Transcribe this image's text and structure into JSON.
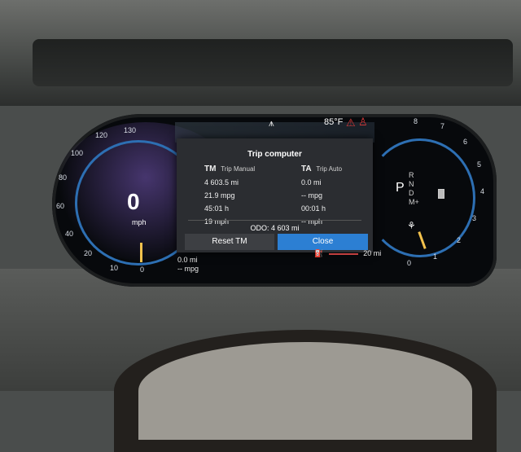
{
  "dashboard": {
    "speedometer": {
      "speed": "0",
      "unit": "mph",
      "scale": [
        "0",
        "10",
        "20",
        "40",
        "60",
        "80",
        "100",
        "120",
        "130"
      ]
    },
    "status": {
      "outside_temp": "85°F"
    },
    "trip_computer": {
      "title": "Trip computer",
      "manual": {
        "code": "TM",
        "label": "Trip Manual",
        "distance": "4 603.5 mi",
        "economy": "21.9 mpg",
        "time": "45:01 h",
        "avg_speed": "19 mph"
      },
      "auto": {
        "code": "TA",
        "label": "Trip Auto",
        "distance": "0.0 mi",
        "economy": "-- mpg",
        "time": "00:01 h",
        "avg_speed": "-- mph"
      },
      "odometer": "ODO:  4 603 mi",
      "reset_label": "Reset TM",
      "close_label": "Close"
    },
    "power_gauge": {
      "scale": [
        "0",
        "1",
        "2",
        "3",
        "4",
        "5",
        "6",
        "7",
        "8"
      ],
      "gear_selected": "P",
      "gears": [
        "R",
        "N",
        "D",
        "M+"
      ]
    },
    "left_trip": {
      "distance": "0.0 mi",
      "economy": "-- mpg"
    },
    "range": {
      "value": "20 mi"
    },
    "icons": {
      "navigation": "road-direction-icon",
      "warning": "warning-triangle-icon",
      "seatbelt": "seatbelt-icon",
      "fuel": "fuel-pump-icon",
      "battery": "battery-icon",
      "eco": "eco-mode-icon"
    },
    "colors": {
      "accent_blue": "#2c7fd3",
      "needle": "#f3c24d",
      "warning": "#e03a3a"
    }
  }
}
